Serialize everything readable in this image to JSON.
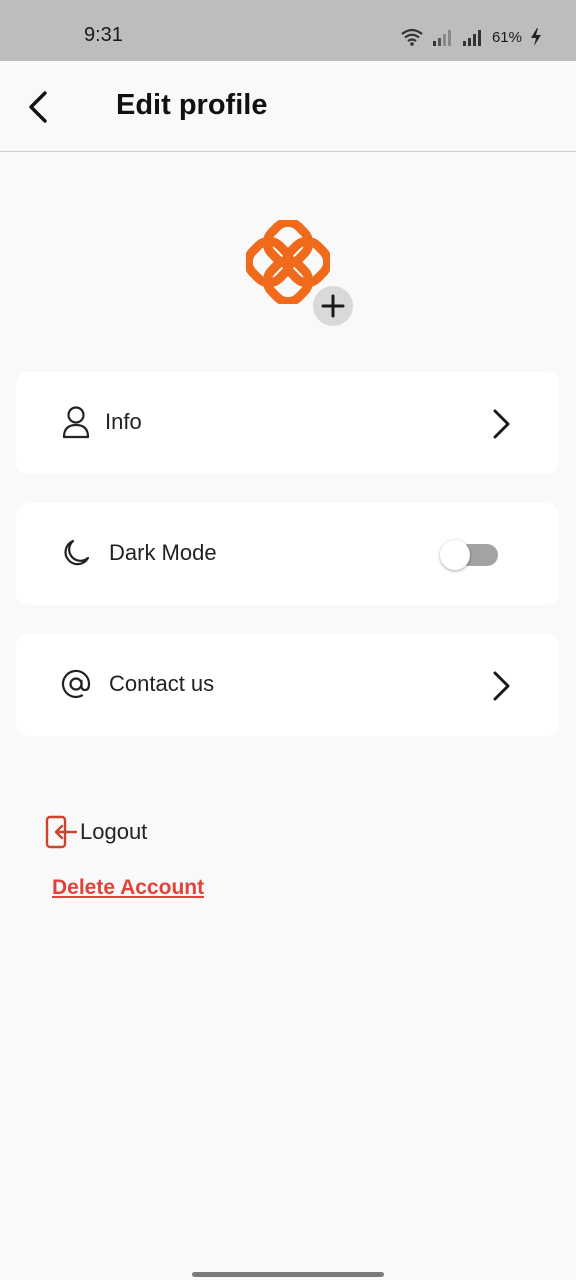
{
  "status_bar": {
    "time": "9:31",
    "battery": "61%",
    "icons": [
      "wifi-icon",
      "signal-icon",
      "signal-icon",
      "battery-charging-icon"
    ]
  },
  "header": {
    "title": "Edit profile",
    "back_icon": "back-arrow-icon"
  },
  "avatar": {
    "logo_icon": "brand-logo-icon",
    "add_icon": "plus-icon"
  },
  "settings": {
    "info": {
      "label": "Info",
      "icon": "user-icon"
    },
    "dark_mode": {
      "label": "Dark Mode",
      "icon": "moon-icon",
      "enabled": false
    },
    "contact": {
      "label": "Contact us",
      "icon": "at-icon"
    }
  },
  "actions": {
    "logout_label": "Logout",
    "delete_label": "Delete Account"
  },
  "colors": {
    "brand_orange": "#f06a1c",
    "danger_red": "#e0433a",
    "logout_icon": "#c8462e",
    "status_bar_bg": "#bdbdbd",
    "page_bg": "#f9f9f9"
  }
}
